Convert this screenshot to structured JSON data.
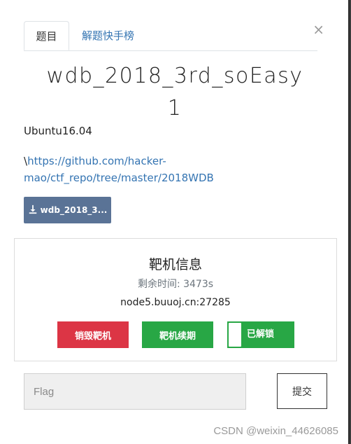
{
  "tabs": [
    {
      "label": "题目"
    },
    {
      "label": "解题快手榜"
    }
  ],
  "close_label": "×",
  "challenge": {
    "title": "wdb_2018_3rd_soEasy",
    "value": "1",
    "os": "Ubuntu16.04",
    "link_prefix": "\\",
    "link": "https://github.com/hacker-mao/ctf_repo/tree/master/2018WDB",
    "download_label": "wdb_2018_3..."
  },
  "target": {
    "title": "靶机信息",
    "remaining": "剩余时间: 3473s",
    "host": "node5.buuoj.cn:27285",
    "destroy_label": "销毁靶机",
    "renew_label": "靶机续期",
    "toggle_label": "已解锁"
  },
  "flag": {
    "placeholder": "Flag",
    "submit_label": "提交"
  },
  "watermark": "CSDN @weixin_44626085",
  "icons": {
    "download": "download-icon",
    "close": "close-icon"
  },
  "colors": {
    "destroy": "#dc3545",
    "renew": "#28a745",
    "download_btn": "#5a7396",
    "link": "#3474b2"
  }
}
